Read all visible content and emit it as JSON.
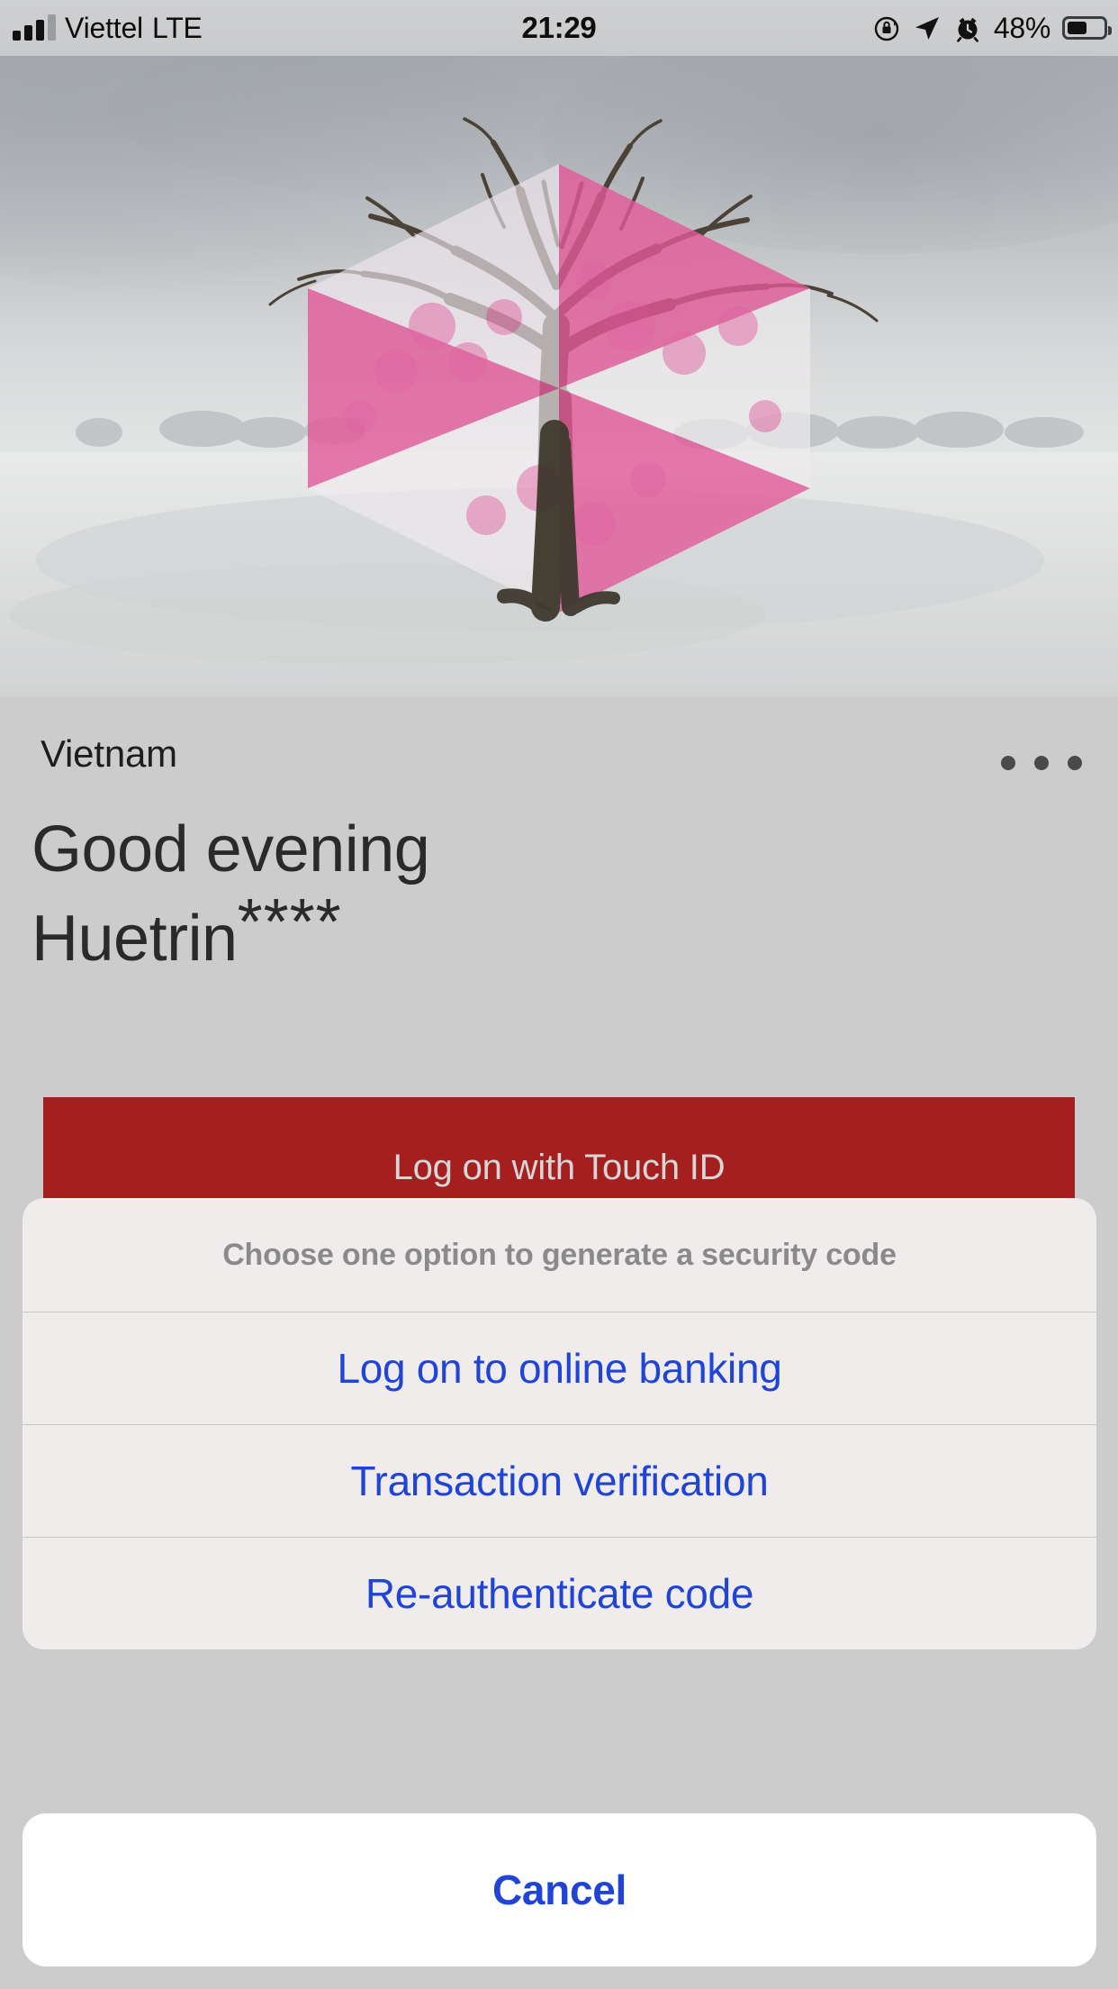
{
  "status_bar": {
    "carrier": "Viettel",
    "network_type": "LTE",
    "time": "21:29",
    "battery_percent": "48%",
    "battery_level": 48,
    "signal_bars_filled": 3,
    "signal_bars_total": 4,
    "icons": [
      "signal-bars-icon",
      "rotation-lock-icon",
      "location-arrow-icon",
      "alarm-clock-icon",
      "battery-icon"
    ]
  },
  "hero": {
    "alt": "Bare tree in snowy winter landscape with pink HSBC hexagon logo overlay",
    "logo_name": "hsbc-hexagon-logo",
    "logo_color": "#db0011"
  },
  "header": {
    "region": "Vietnam",
    "more_menu": "more-options-icon"
  },
  "greeting": {
    "salutation": "Good evening",
    "username": "Huetrin",
    "mask": "****"
  },
  "primary_action": {
    "label": "Log on with Touch ID",
    "background": "#a41f1e",
    "text_color": "#d6d6d6"
  },
  "action_sheet": {
    "title": "Choose one option to generate a security code",
    "options": [
      {
        "label": "Log on to online banking"
      },
      {
        "label": "Transaction verification"
      },
      {
        "label": "Re-authenticate code"
      }
    ],
    "cancel_label": "Cancel",
    "accent_color": "#1f44d6",
    "background": "#f0ecec"
  }
}
